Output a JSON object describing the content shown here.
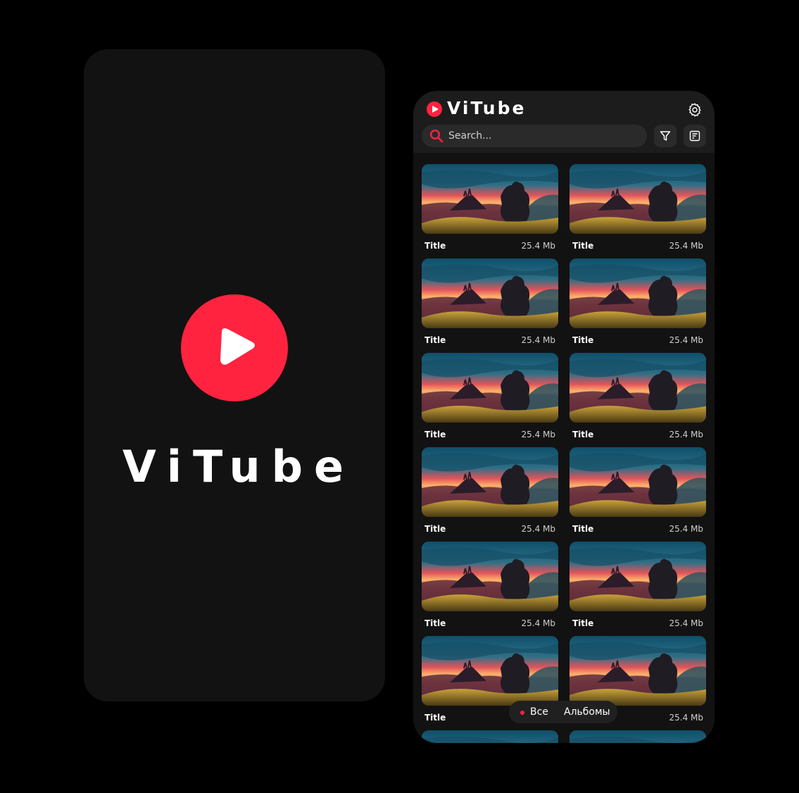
{
  "brand": {
    "name": "ViTube",
    "accent_color": "#FF2340",
    "logo_icon": "play-icon"
  },
  "header": {
    "settings_icon": "gear-icon",
    "filter_icon": "filter-icon",
    "sort_icon": "sort-icon"
  },
  "search": {
    "placeholder": "Search...",
    "value": ""
  },
  "videos": [
    {
      "title": "Title",
      "size": "25.4 Mb"
    },
    {
      "title": "Title",
      "size": "25.4 Mb"
    },
    {
      "title": "Title",
      "size": "25.4 Mb"
    },
    {
      "title": "Title",
      "size": "25.4 Mb"
    },
    {
      "title": "Title",
      "size": "25.4 Mb"
    },
    {
      "title": "Title",
      "size": "25.4 Mb"
    },
    {
      "title": "Title",
      "size": "25.4 Mb"
    },
    {
      "title": "Title",
      "size": "25.4 Mb"
    },
    {
      "title": "Title",
      "size": "25.4 Mb"
    },
    {
      "title": "Title",
      "size": "25.4 Mb"
    },
    {
      "title": "Title",
      "size": ""
    },
    {
      "title": "",
      "size": "25.4 Mb"
    },
    {
      "title": "",
      "size": ""
    },
    {
      "title": "",
      "size": ""
    }
  ],
  "bottom_nav": {
    "all_label": "Все",
    "albums_label": "Альбомы",
    "active": "Все"
  }
}
